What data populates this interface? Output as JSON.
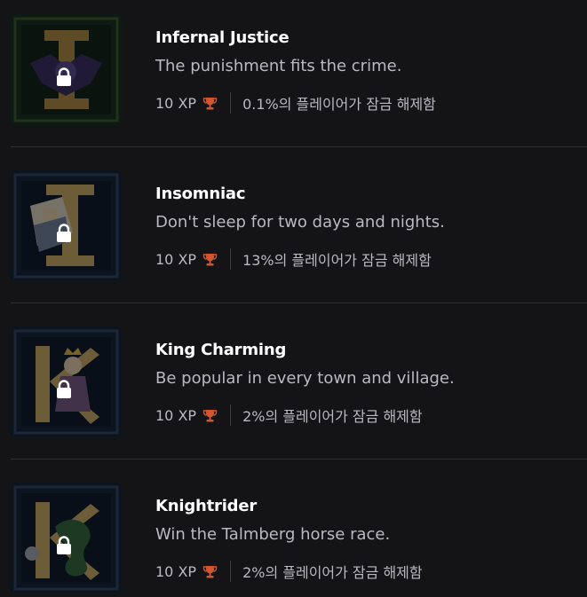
{
  "accent_color": "#d2552d",
  "lock_icon": "lock-icon",
  "trophy_icon": "trophy-icon",
  "achievements": [
    {
      "title": "Infernal Justice",
      "description": "The punishment fits the crime.",
      "xp": "10 XP",
      "unlock_rate": "0.1%의 플레이어가 잠금 해제함",
      "locked": true,
      "icon": "letter-i-bat-emblem"
    },
    {
      "title": "Insomniac",
      "description": "Don't sleep for two days and nights.",
      "xp": "10 XP",
      "unlock_rate": "13%의 플레이어가 잠금 해제함",
      "locked": true,
      "icon": "letter-i-sleeper-emblem"
    },
    {
      "title": "King Charming",
      "description": "Be popular in every town and village.",
      "xp": "10 XP",
      "unlock_rate": "2%의 플레이어가 잠금 해제함",
      "locked": true,
      "icon": "letter-k-king-emblem"
    },
    {
      "title": "Knightrider",
      "description": "Win the Talmberg horse race.",
      "xp": "10 XP",
      "unlock_rate": "2%의 플레이어가 잠금 해제함",
      "locked": true,
      "icon": "letter-k-dragon-emblem"
    }
  ]
}
